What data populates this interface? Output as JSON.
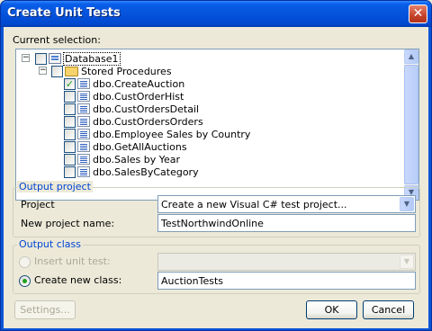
{
  "window": {
    "title": "Create Unit Tests",
    "close_glyph": "✕"
  },
  "selection": {
    "label": "Current selection:",
    "tree": [
      {
        "label": "Database1",
        "expander": "−",
        "checked": false,
        "icon": "database-icon"
      },
      {
        "label": "Stored Procedures",
        "expander": "−",
        "checked": false,
        "icon": "folder-icon"
      },
      {
        "label": "dbo.CreateAuction",
        "checked": true,
        "icon": "stored-procedure-icon"
      },
      {
        "label": "dbo.CustOrderHist",
        "checked": false,
        "icon": "stored-procedure-icon"
      },
      {
        "label": "dbo.CustOrdersDetail",
        "checked": false,
        "icon": "stored-procedure-icon"
      },
      {
        "label": "dbo.CustOrdersOrders",
        "checked": false,
        "icon": "stored-procedure-icon"
      },
      {
        "label": "dbo.Employee Sales by Country",
        "checked": false,
        "icon": "stored-procedure-icon"
      },
      {
        "label": "dbo.GetAllAuctions",
        "checked": false,
        "icon": "stored-procedure-icon"
      },
      {
        "label": "dbo.Sales by Year",
        "checked": false,
        "icon": "stored-procedure-icon"
      },
      {
        "label": "dbo.SalesByCategory",
        "checked": false,
        "icon": "stored-procedure-icon"
      }
    ],
    "scroll_up_glyph": "▲",
    "scroll_down_glyph": "▼"
  },
  "output_project": {
    "title": "Output project",
    "project_label": "Project",
    "project_value": "Create a new Visual C# test project...",
    "new_project_label": "New project name:",
    "new_project_value": "TestNorthwindOnline",
    "dropdown_glyph": "▼"
  },
  "output_class": {
    "title": "Output class",
    "insert_label": "Insert unit test:",
    "insert_value": "",
    "create_label": "Create new class:",
    "create_value": "AuctionTests",
    "selected_option": "create"
  },
  "buttons": {
    "settings": "Settings...",
    "ok": "OK",
    "cancel": "Cancel"
  },
  "colors": {
    "titlebar": "#0553dc",
    "group_title": "#0046d5",
    "check": "#21a121",
    "dialog_bg": "#ece9d8"
  }
}
